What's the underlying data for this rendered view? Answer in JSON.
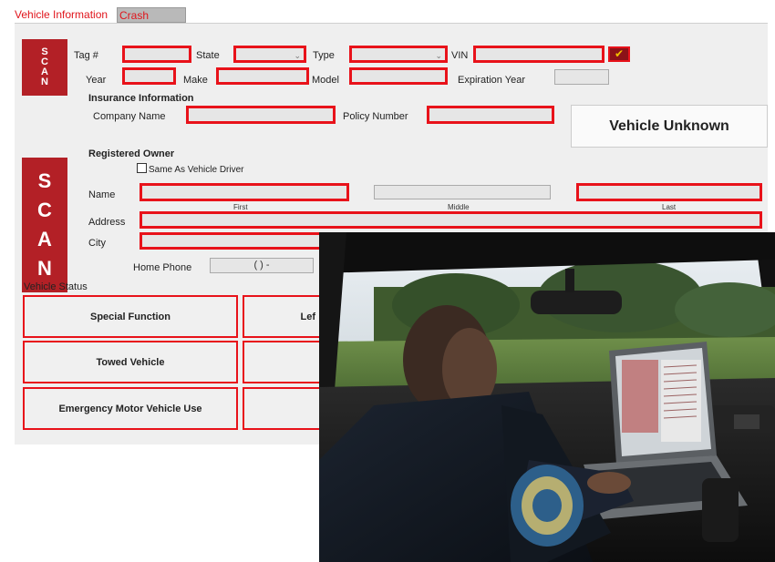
{
  "tabs": {
    "vehicle_info": "Vehicle Information",
    "crash_details": "Crash Details"
  },
  "scan": {
    "letters": [
      "S",
      "C",
      "A",
      "N"
    ]
  },
  "vehicle": {
    "tag_label": "Tag #",
    "state_label": "State",
    "type_label": "Type",
    "vin_label": "VIN",
    "year_label": "Year",
    "make_label": "Make",
    "model_label": "Model",
    "expiration_year_label": "Expiration Year"
  },
  "insurance": {
    "heading": "Insurance Information",
    "company_label": "Company Name",
    "policy_label": "Policy Number"
  },
  "vehicle_unknown_label": "Vehicle Unknown",
  "owner": {
    "heading": "Registered Owner",
    "same_as_driver_label": "Same As Vehicle Driver",
    "name_label": "Name",
    "first_label": "First",
    "middle_label": "Middle",
    "last_label": "Last",
    "address_label": "Address",
    "city_label": "City",
    "home_phone_label": "Home Phone",
    "home_phone_value": "(    )    -"
  },
  "vehicle_status": {
    "heading": "Vehicle Status",
    "buttons": [
      "Special Function",
      "Towed Vehicle",
      "Emergency Motor Vehicle Use"
    ],
    "partial_button": "Lef"
  },
  "colors": {
    "accent_red": "#e8121a",
    "scan_red": "#b32026",
    "panel_gray": "#efefef"
  },
  "icons": {
    "vin_check": "checkmark-icon",
    "dropdown": "chevron-down-icon"
  }
}
